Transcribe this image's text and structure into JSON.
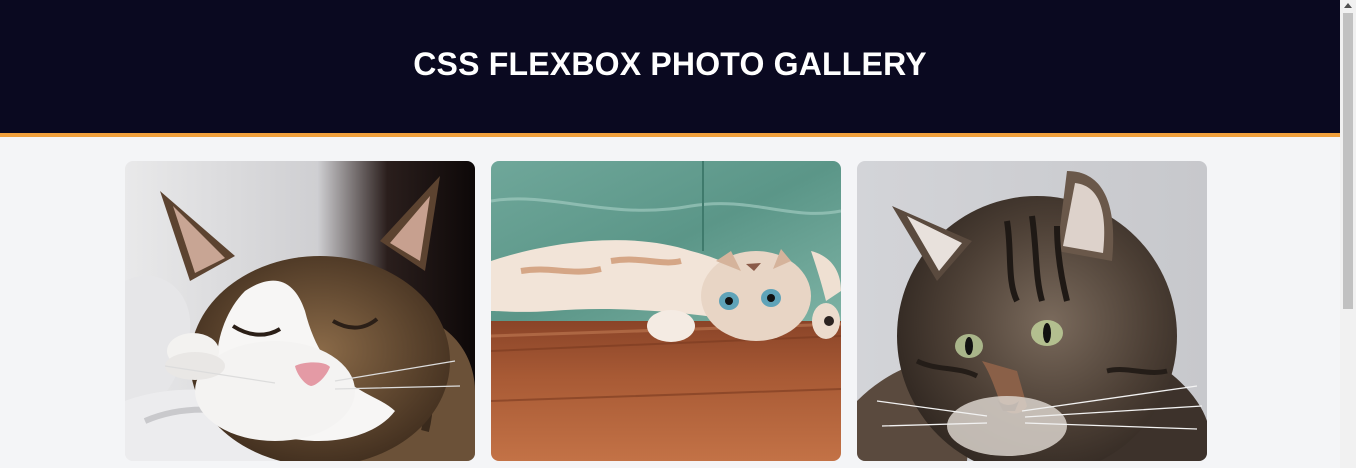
{
  "header": {
    "title": "CSS FLEXBOX PHOTO GALLERY",
    "background_color": "#0a0920",
    "accent_color": "#f0a03c"
  },
  "gallery": {
    "photos": [
      {
        "subject": "sleeping-white-tabby-cat"
      },
      {
        "subject": "cat-lying-upside-down-on-wooden-floor"
      },
      {
        "subject": "fluffy-gray-tabby-cat"
      }
    ]
  },
  "scrollbar": {
    "icon": "arrow-up-icon"
  }
}
